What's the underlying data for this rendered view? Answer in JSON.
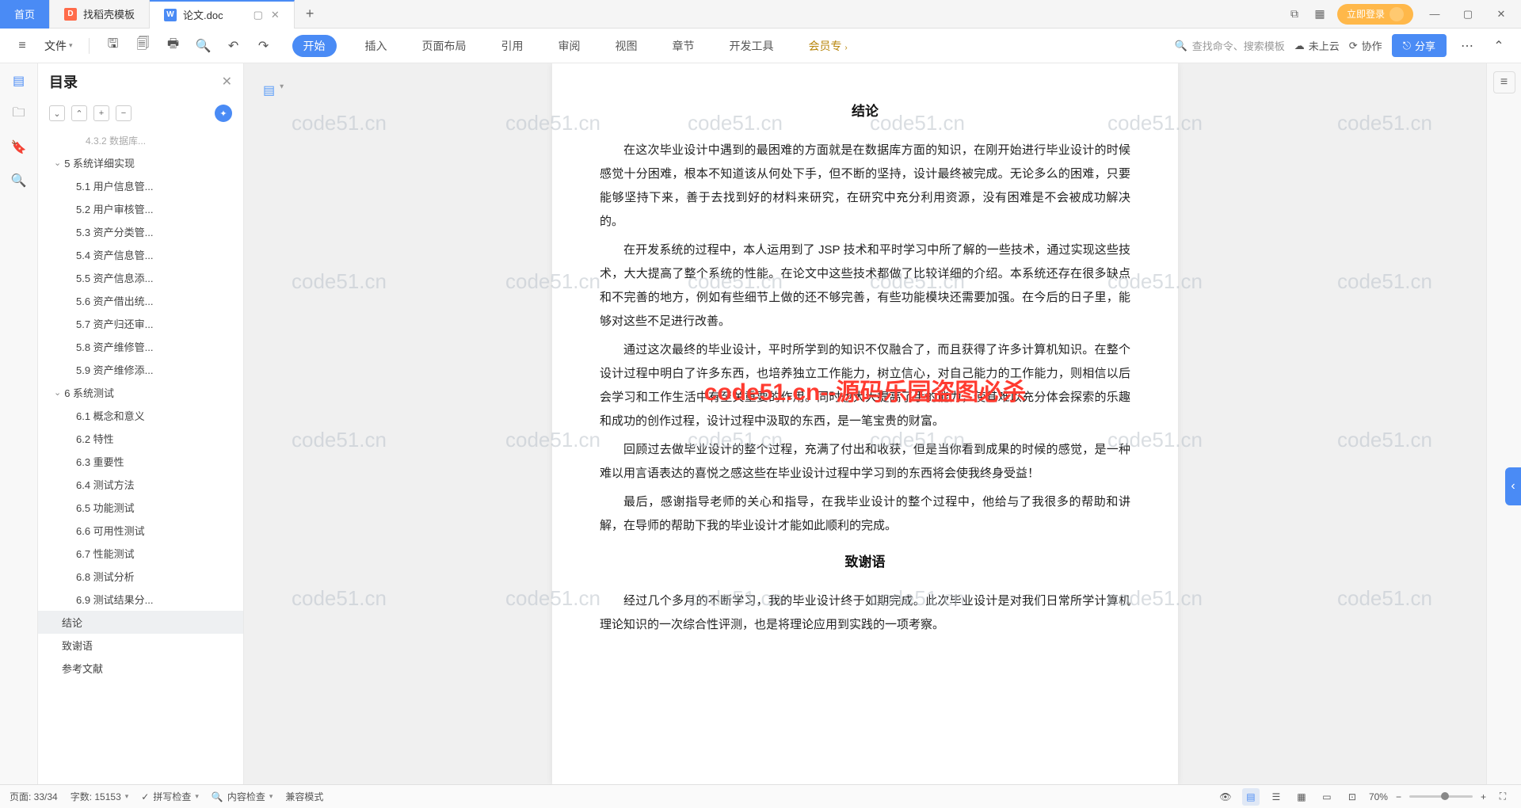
{
  "titlebar": {
    "tabs": [
      {
        "label": "首页",
        "type": "home"
      },
      {
        "label": "找稻壳模板",
        "type": "d"
      },
      {
        "label": "论文.doc",
        "type": "w",
        "active": true
      }
    ],
    "login": "立即登录"
  },
  "toolbar": {
    "file_menu": "文件",
    "nav": [
      "开始",
      "插入",
      "页面布局",
      "引用",
      "审阅",
      "视图",
      "章节",
      "开发工具",
      "会员专"
    ],
    "active_nav": "开始",
    "search_hint": "查找命令、搜索模板",
    "cloud": "未上云",
    "collab": "协作",
    "share": "分享"
  },
  "toc": {
    "title": "目录",
    "items": [
      {
        "label": "4.3.2 数据库...",
        "level": "dim"
      },
      {
        "label": "5 系统详细实现",
        "level": "l1"
      },
      {
        "label": "5.1 用户信息管...",
        "level": "l2"
      },
      {
        "label": "5.2 用户审核管...",
        "level": "l2"
      },
      {
        "label": "5.3 资产分类管...",
        "level": "l2"
      },
      {
        "label": "5.4 资产信息管...",
        "level": "l2"
      },
      {
        "label": "5.5 资产信息添...",
        "level": "l2"
      },
      {
        "label": "5.6 资产借出统...",
        "level": "l2"
      },
      {
        "label": "5.7 资产归还审...",
        "level": "l2"
      },
      {
        "label": "5.8 资产维修管...",
        "level": "l2"
      },
      {
        "label": "5.9 资产维修添...",
        "level": "l2"
      },
      {
        "label": "6 系统测试",
        "level": "l1"
      },
      {
        "label": "6.1 概念和意义",
        "level": "l2"
      },
      {
        "label": "6.2 特性",
        "level": "l2"
      },
      {
        "label": "6.3 重要性",
        "level": "l2"
      },
      {
        "label": "6.4 测试方法",
        "level": "l2"
      },
      {
        "label": "6.5 功能测试",
        "level": "l2"
      },
      {
        "label": "6.6 可用性测试",
        "level": "l2"
      },
      {
        "label": "6.7 性能测试",
        "level": "l2"
      },
      {
        "label": "6.8 测试分析",
        "level": "l2"
      },
      {
        "label": "6.9 测试结果分...",
        "level": "l2"
      },
      {
        "label": "结论",
        "level": "l0",
        "selected": true
      },
      {
        "label": "致谢语",
        "level": "l0"
      },
      {
        "label": "参考文献",
        "level": "l0"
      }
    ]
  },
  "document": {
    "h1": "结论",
    "p1": "在这次毕业设计中遇到的最困难的方面就是在数据库方面的知识，在刚开始进行毕业设计的时候感觉十分困难，根本不知道该从何处下手，但不断的坚持，设计最终被完成。无论多么的困难，只要能够坚持下来，善于去找到好的材料来研究，在研究中充分利用资源，没有困难是不会被成功解决的。",
    "p2": "在开发系统的过程中，本人运用到了 JSP 技术和平时学习中所了解的一些技术，通过实现这些技术，大大提高了整个系统的性能。在论文中这些技术都做了比较详细的介绍。本系统还存在很多缺点和不完善的地方，例如有些细节上做的还不够完善，有些功能模块还需要加强。在今后的日子里，能够对这些不足进行改善。",
    "p3": "通过这次最终的毕业设计，平时所学到的知识不仅融合了，而且获得了许多计算机知识。在整个设计过程中明白了许多东西，也培养独立工作能力，树立信心，对自己能力的工作能力，则相信以后会学习和工作生活中有至关重要的作用。同时也大大提高了手的能力，使其难以充分体会探索的乐趣和成功的创作过程，设计过程中汲取的东西，是一笔宝贵的财富。",
    "p4": "回顾过去做毕业设计的整个过程，充满了付出和收获，但是当你看到成果的时候的感觉，是一种难以用言语表达的喜悦之感这些在毕业设计过程中学习到的东西将会使我终身受益！",
    "p5": "最后，感谢指导老师的关心和指导，在我毕业设计的整个过程中，他给与了我很多的帮助和讲解，在导师的帮助下我的毕业设计才能如此顺利的完成。",
    "h2": "致谢语",
    "p6": "经过几个多月的不断学习，我的毕业设计终于如期完成。此次毕业设计是对我们日常所学计算机理论知识的一次综合性评测，也是将理论应用到实践的一项考察。"
  },
  "watermark_main": "code51.cn--源码乐园盗图必杀",
  "watermark_bg": "code51.cn",
  "statusbar": {
    "page": "页面: 33/34",
    "words": "字数: 15153",
    "spell": "拼写检查",
    "content": "内容检查",
    "compat": "兼容模式",
    "zoom": "70%"
  }
}
